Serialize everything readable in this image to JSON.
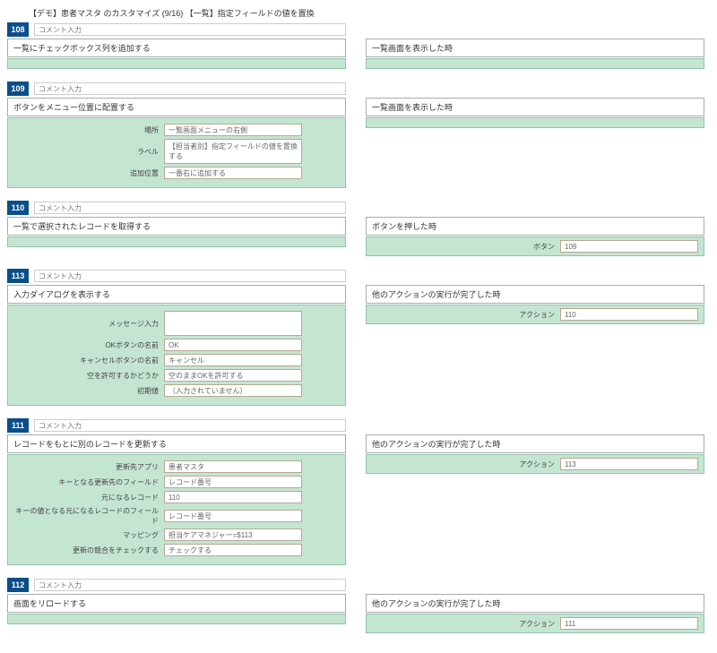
{
  "header": "【デモ】患者マスタ のカスタマイズ (9/16) 【一覧】指定フィールドの値を置換",
  "comment_placeholder": "コメント入力",
  "blocks": [
    {
      "num": "108",
      "left_title": "一覧にチェックボックス列を追加する",
      "right_title": "一覧画面を表示した時",
      "left_fields": [],
      "right_fields": []
    },
    {
      "num": "109",
      "left_title": "ボタンをメニュー位置に配置する",
      "right_title": "一覧画面を表示した時",
      "left_fields": [
        {
          "label": "場所",
          "value": "一覧画面メニューの右側",
          "type": "text"
        },
        {
          "label": "ラベル",
          "value": "【担当者別】指定フィールドの値を置換する",
          "type": "textarea"
        },
        {
          "label": "追加位置",
          "value": "一番右に追加する",
          "type": "text"
        }
      ],
      "right_fields": []
    },
    {
      "num": "110",
      "left_title": "一覧で選択されたレコードを取得する",
      "right_title": "ボタンを押した時",
      "left_fields": [],
      "right_fields": [
        {
          "label": "ボタン",
          "value": "109"
        }
      ]
    },
    {
      "num": "113",
      "left_title": "入力ダイアログを表示する",
      "right_title": "他のアクションの実行が完了した時",
      "left_fields": [
        {
          "label": "メッセージ入力",
          "value": "",
          "type": "textarea"
        },
        {
          "label": "OKボタンの名前",
          "value": "OK",
          "type": "text"
        },
        {
          "label": "キャンセルボタンの名前",
          "value": "キャンセル",
          "type": "text"
        },
        {
          "label": "空を許可するかどうか",
          "value": "空のままOKを許可する",
          "type": "text"
        },
        {
          "label": "初期値",
          "value": "（入力されていません）",
          "type": "text"
        }
      ],
      "right_fields": [
        {
          "label": "アクション",
          "value": "110"
        }
      ]
    },
    {
      "num": "111",
      "left_title": "レコードをもとに別のレコードを更新する",
      "right_title": "他のアクションの実行が完了した時",
      "left_fields": [
        {
          "label": "更新先アプリ",
          "value": "患者マスタ",
          "type": "text"
        },
        {
          "label": "キーとなる更新先のフィールド",
          "value": "レコード番号",
          "type": "text"
        },
        {
          "label": "元になるレコード",
          "value": "110",
          "type": "text"
        },
        {
          "label": "キーの値となる元になるレコードのフィールド",
          "value": "レコード番号",
          "type": "text"
        },
        {
          "label": "マッピング",
          "value": "担当ケアマネジャー=$113",
          "type": "text"
        },
        {
          "label": "更新の競合をチェックする",
          "value": "チェックする",
          "type": "text"
        }
      ],
      "right_fields": [
        {
          "label": "アクション",
          "value": "113"
        }
      ]
    },
    {
      "num": "112",
      "left_title": "画面をリロードする",
      "right_title": "他のアクションの実行が完了した時",
      "left_fields": [],
      "right_fields": [
        {
          "label": "アクション",
          "value": "111"
        }
      ]
    }
  ]
}
